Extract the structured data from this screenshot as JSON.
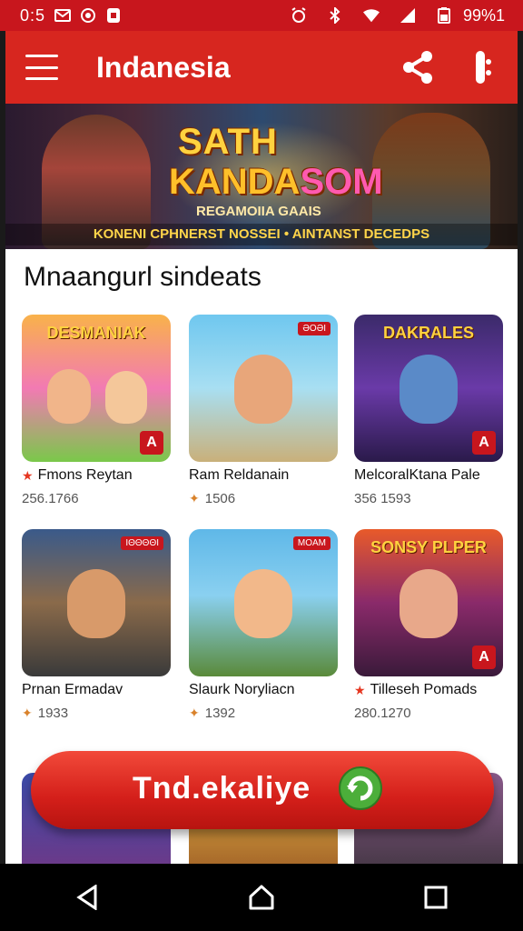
{
  "status_bar": {
    "time": "0:5",
    "battery": "99%1",
    "icons": [
      "mail-icon",
      "record-icon",
      "shield-icon",
      "alarm-icon",
      "bluetooth-icon",
      "wifi-icon",
      "signal-icon",
      "battery-icon"
    ]
  },
  "app_bar": {
    "title": "Indanesia",
    "menu_icon": "menu-icon",
    "share_icon": "share-icon",
    "more_icon": "more-icon"
  },
  "banner": {
    "title_line1": "SATH",
    "title_line2_a": "KANDA",
    "title_line2_b": "SOM",
    "subtitle": "REGAMOIIA GAAIS",
    "tagline": "KONENI CPHNERST NOSSEI • AINTANST DECEDPS"
  },
  "section": {
    "title": "Mnaangurl sindeats"
  },
  "games": [
    {
      "title": "DESMANIAK",
      "tag": "",
      "name": "Fmons Reytan",
      "stat": "256.1766",
      "starred": true,
      "sparked": false
    },
    {
      "title": "",
      "tag": "ƏOƏI",
      "name": "Ram Reldanain",
      "stat": "1506",
      "starred": false,
      "sparked": true
    },
    {
      "title": "DAKRALES",
      "tag": "",
      "name": "MelcoralKtana Pale",
      "stat": "356 1593",
      "starred": false,
      "sparked": false
    },
    {
      "title": "",
      "tag": "ΙΘΘΘΘΙ",
      "name": "Prnan Ermadav",
      "stat": "1933",
      "starred": false,
      "sparked": true
    },
    {
      "title": "",
      "tag": "MOAM",
      "name": "Slaurk Noryliacn",
      "stat": "1392",
      "starred": false,
      "sparked": true
    },
    {
      "title": "SONSY PLPER",
      "tag": "",
      "name": "Tilleseh Pomads",
      "stat": "280.1270",
      "starred": true,
      "sparked": false
    }
  ],
  "cta": {
    "label": "Tnd.ekaliye"
  },
  "nav": {
    "back": "back-icon",
    "home": "home-icon",
    "recents": "recents-icon"
  },
  "colors": {
    "primary": "#d7261f",
    "status": "#c8161d",
    "cta": "#d41f1a"
  }
}
